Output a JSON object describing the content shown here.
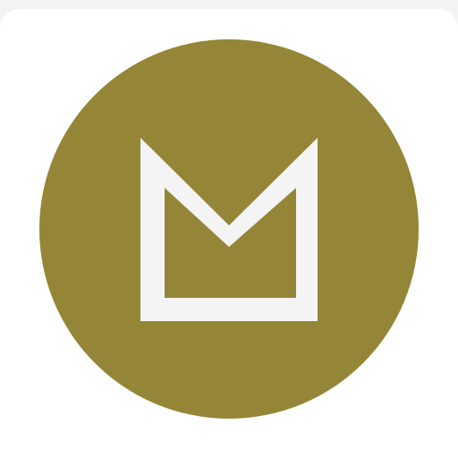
{
  "icon": {
    "name": "m-monogram-logo-icon",
    "circle_color": "#958536",
    "glyph_color": "#f4f4f4",
    "card_color": "#ffffff",
    "background_color": "#f3f3f3"
  }
}
